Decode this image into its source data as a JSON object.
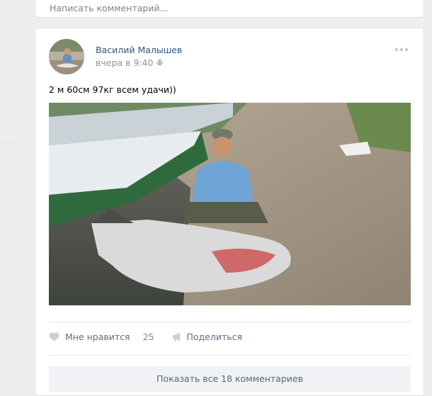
{
  "comment_box": {
    "placeholder": "Написать комментарий..."
  },
  "post": {
    "author": "Василий Малышев",
    "timestamp": "вчера в 9:40",
    "text": "2 м 60см 97кг всем удачи))",
    "actions": {
      "like_label": "Мне нравится",
      "like_count": "25",
      "share_label": "Поделиться"
    },
    "show_comments_label": "Показать все 18 комментариев"
  },
  "colors": {
    "author": "#2a5885",
    "action_text": "#5e6c7f",
    "like_count": "#6d8ca6"
  },
  "icons": [
    "android-icon",
    "more-icon",
    "heart-icon",
    "megaphone-icon"
  ]
}
